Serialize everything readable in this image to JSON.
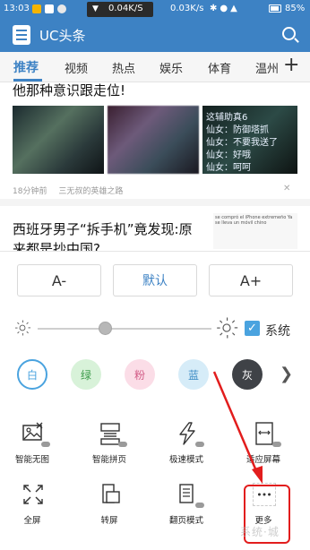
{
  "status_bar": {
    "time": "13:03",
    "speed_left": "0.04K/S",
    "speed_right": "0.03K/s",
    "battery": "85%"
  },
  "app_bar": {
    "title": "UC头条"
  },
  "tabs": [
    {
      "label": "推荐",
      "active": true
    },
    {
      "label": "视频"
    },
    {
      "label": "热点"
    },
    {
      "label": "娱乐"
    },
    {
      "label": "体育"
    },
    {
      "label": "温州"
    }
  ],
  "feed": {
    "item1": {
      "title": "他那种意识跟走位!",
      "thumb_text": [
        "这辅助真6",
        "仙女：防御塔抓",
        "仙女：不要我送了",
        "仙女：好哦",
        "仙女：呵呵"
      ],
      "time": "18分钟前",
      "source": "三无叔的英雄之路"
    },
    "item2": {
      "title": "西班牙男子“拆手机”竟发现:原来都是抄中国?",
      "thumb_text": "se compró el iPhone extremeño Ya se lleva un móvil chino"
    }
  },
  "panel": {
    "font_small": "A-",
    "font_default": "默认",
    "font_large": "A+",
    "brightness_value": 0.39,
    "system_label": "系统",
    "system_checked": true,
    "themes": [
      {
        "label": "白",
        "selected": true,
        "color": "#ffffff"
      },
      {
        "label": "绿",
        "color": "#d8f2d9"
      },
      {
        "label": "粉",
        "color": "#fbdde7"
      },
      {
        "label": "蓝",
        "color": "#d6ecf8"
      },
      {
        "label": "灰",
        "color": "#3f4247"
      }
    ],
    "tools": [
      {
        "label": "智能无图",
        "icon": "image-off-icon"
      },
      {
        "label": "智能拼页",
        "icon": "page-merge-icon"
      },
      {
        "label": "极速模式",
        "icon": "lightning-icon"
      },
      {
        "label": "适应屏幕",
        "icon": "fit-screen-icon"
      },
      {
        "label": "全屏",
        "icon": "fullscreen-icon"
      },
      {
        "label": "转屏",
        "icon": "rotate-screen-icon"
      },
      {
        "label": "翻页模式",
        "icon": "page-turn-icon"
      },
      {
        "label": "更多",
        "icon": "more-icon"
      }
    ]
  },
  "watermark": "系统·城"
}
